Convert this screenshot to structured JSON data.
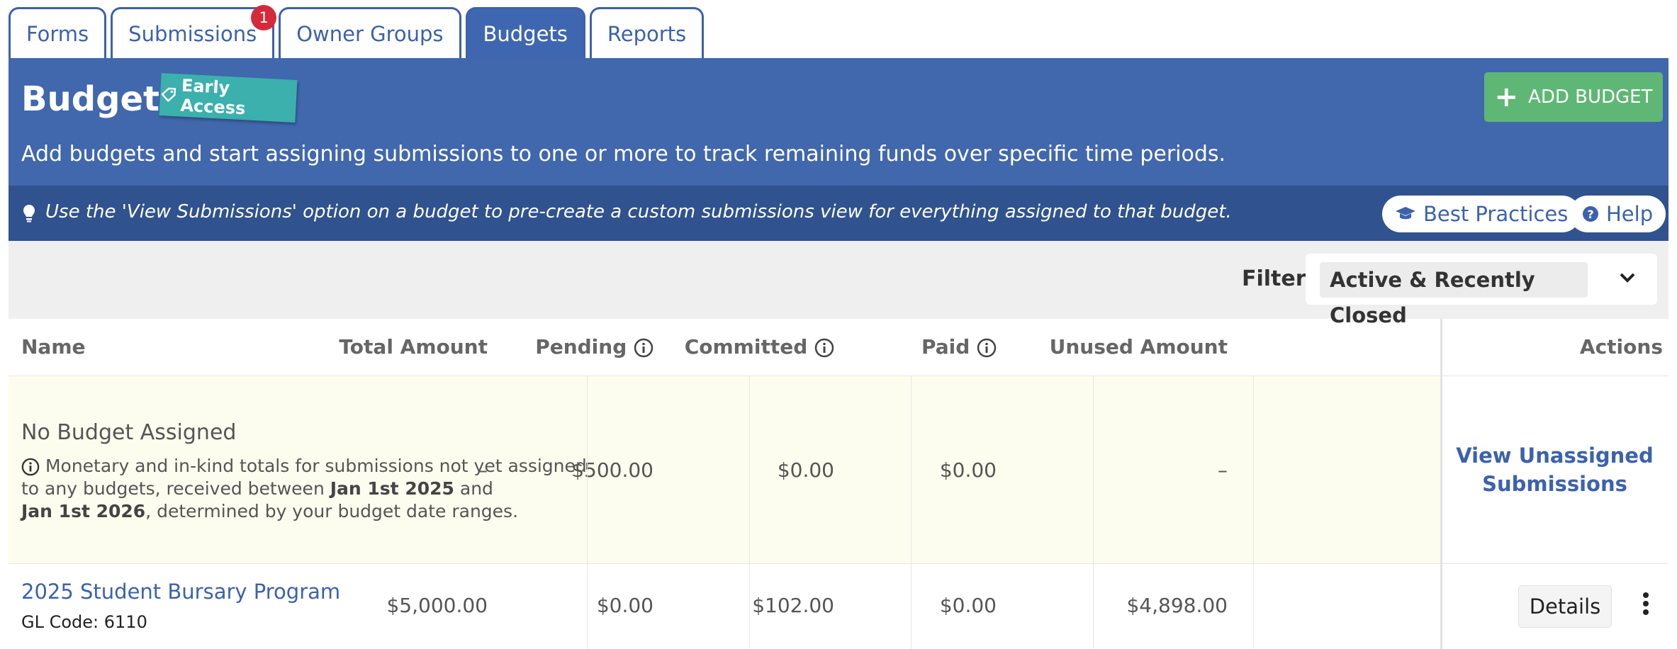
{
  "tabs": [
    {
      "label": "Forms"
    },
    {
      "label": "Submissions",
      "badge": "1"
    },
    {
      "label": "Owner Groups"
    },
    {
      "label": "Budgets"
    },
    {
      "label": "Reports"
    }
  ],
  "header": {
    "title": "Budgets",
    "badge": "Early Access",
    "add_button": "ADD BUDGET",
    "description": "Add budgets and start assigning submissions to one or more to track remaining funds over specific time periods.",
    "colors": {
      "header_bg": "#4167ad",
      "tip_bg": "#30528f",
      "add_button": "#5fb775",
      "badge": "#3bb0ad",
      "tab_badge": "#d42a3b"
    }
  },
  "tip": {
    "icon": "lightbulb-icon",
    "text": "Use the 'View Submissions' option on a budget to pre-create a custom submissions view for everything assigned to that budget.",
    "best_practices": "Best Practices",
    "help": "Help"
  },
  "filter": {
    "label": "Filter",
    "value": "Active & Recently Closed"
  },
  "table": {
    "headers": {
      "name": "Name",
      "total": "Total Amount",
      "pending": "Pending",
      "committed": "Committed",
      "paid": "Paid",
      "unused": "Unused Amount",
      "actions": "Actions"
    },
    "unassigned": {
      "title": "No Budget Assigned",
      "desc_1": "Monetary and in-kind totals for submissions not yet assigned",
      "desc_2a": "to any budgets, received between ",
      "desc_2b": "Jan 1st 2025",
      "desc_2c": " and",
      "desc_3a": "Jan 1st 2026",
      "desc_3b": ", determined by your budget date ranges.",
      "total": "–",
      "pending": "$500.00",
      "committed": "$0.00",
      "paid": "$0.00",
      "unused": "–",
      "action_1": "View Unassigned",
      "action_2": "Submissions"
    },
    "budget_row": {
      "name": "2025 Student Bursary Program",
      "gl_code": "GL Code: 6110",
      "total": "$5,000.00",
      "pending": "$0.00",
      "committed": "$102.00",
      "paid": "$0.00",
      "unused": "$4,898.00",
      "details": "Details"
    }
  }
}
